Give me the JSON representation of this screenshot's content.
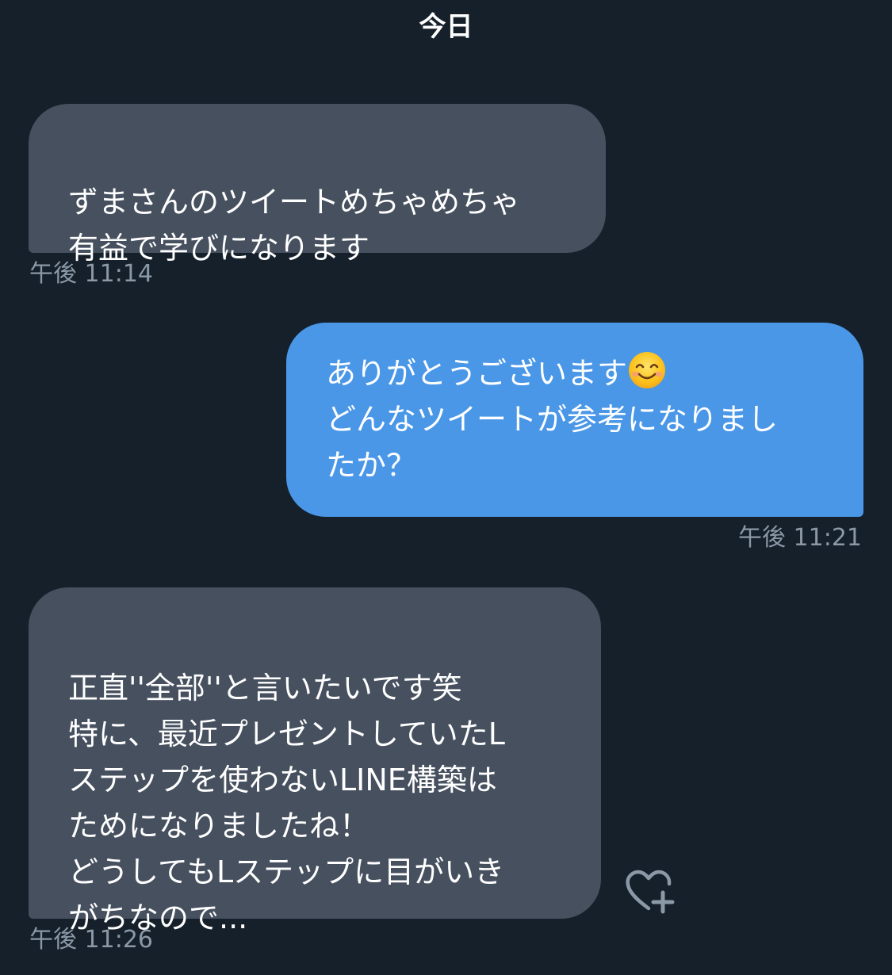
{
  "header": {
    "date_label": "今日"
  },
  "messages": [
    {
      "direction": "received",
      "text": "ずまさんのツイートめちゃめちゃ\n有益で学びになります",
      "time": "午後 11:14"
    },
    {
      "direction": "sent",
      "text_before_emoji": "ありがとうございます",
      "emoji": "smiling-face-icon",
      "text_after_emoji": "\nどんなツイートが参考になりまし\nたか？",
      "time": "午後 11:21"
    },
    {
      "direction": "received",
      "text": "正直''全部''と言いたいです笑\n特に、最近プレゼントしていたL\nステップを使わないLINE構築は\nためになりましたね！\nどうしてもLステップに目がいき\nがちなので...",
      "time": "午後 11:26",
      "reaction_icon": "heart-plus-icon"
    }
  ],
  "colors": {
    "background": "#15202b",
    "received_bubble": "#46505e",
    "sent_bubble": "#4a97e8",
    "timestamp": "#8b98a5"
  }
}
